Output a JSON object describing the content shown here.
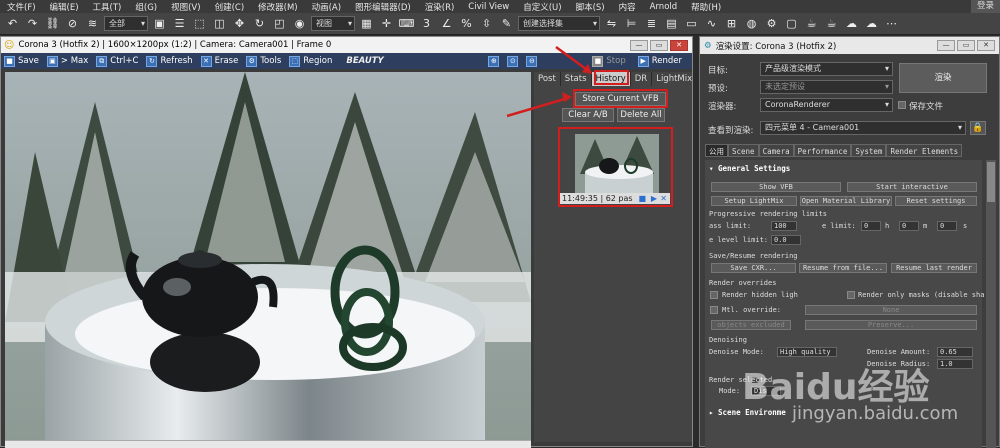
{
  "menu": {
    "items": [
      "文件(F)",
      "编辑(E)",
      "工具(T)",
      "组(G)",
      "视图(V)",
      "创建(C)",
      "修改器(M)",
      "动画(A)",
      "图形编辑器(D)",
      "渲染(R)",
      "Civil View",
      "自定义(U)",
      "脚本(S)",
      "内容",
      "Arnold",
      "帮助(H)"
    ],
    "login": "登录"
  },
  "toolbar": {
    "selection_filter": "全部",
    "view": "视图",
    "selection_set": "创建选择集"
  },
  "vfb": {
    "title": "Corona 3 (Hotfix 2) | 1600×1200px (1:2) | Camera: Camera001 | Frame 0",
    "tools": {
      "save": "Save",
      "max": "> Max",
      "ctrlc": "Ctrl+C",
      "refresh": "Refresh",
      "erase": "Erase",
      "tools": "Tools",
      "region": "Region",
      "channel": "BEAUTY"
    },
    "stop": "Stop",
    "render": "Render",
    "side_tabs": [
      "Post",
      "Stats",
      "History",
      "DR",
      "LightMix"
    ],
    "store_vfb": "Store Current VFB",
    "clear_ab": "Clear A/B",
    "delete_all": "Delete All",
    "thumb_info": "11:49:35 | 62 pas"
  },
  "render_setup": {
    "title": "渲染设置: Corona 3 (Hotfix 2)",
    "target_label": "目标:",
    "target_value": "产品级渲染模式",
    "preset_label": "预设:",
    "preset_value": "未选定预设",
    "renderer_label": "渲染器:",
    "renderer_value": "CoronaRenderer",
    "save_file": "保存文件",
    "render_button": "渲染",
    "view_label": "查看到渲染:",
    "view_value": "四元菜单 4 - Camera001",
    "tabs": [
      "公用",
      "Scene",
      "Camera",
      "Performance",
      "System",
      "Render Elements"
    ],
    "general_settings": "General Settings",
    "show_vfb": "Show VFB",
    "start_interactive": "Start interactive",
    "setup_lightmix": "Setup LightMix",
    "open_material_library": "Open Material Library",
    "reset_settings": "Reset settings",
    "progressive_limits": "Progressive rendering limits",
    "pass_limit_label": "ass limit:",
    "pass_limit_value": "100",
    "time_limit_label": "e limit:",
    "time_h": "0",
    "time_m": "0",
    "time_s": "0",
    "h": "h",
    "m": "m",
    "s": "s",
    "noise_label": "e level limit:",
    "noise_value": "0.0",
    "save_resume": "Save/Resume rendering",
    "save_cxr": "Save CXR...",
    "resume_file": "Resume from file...",
    "resume_last": "Resume last render",
    "render_overrides": "Render overrides",
    "render_hidden": "Render hidden ligh",
    "render_only_masks": "Render only masks (disable sha",
    "mtl_override": "Mtl. override:",
    "none": "None",
    "objects_excluded": "objects excluded",
    "preserve": "Preserve...",
    "denoising": "Denoising",
    "denoise_mode_label": "Denoise Mode:",
    "denoise_mode_value": "High quality",
    "denoise_amount_label": "Denoise Amount:",
    "denoise_amount_value": "0.65",
    "denoise_radius_label": "Denoise Radius:",
    "denoise_radius_value": "1.0",
    "render_selected": "Render selected",
    "mode_label": "Mode:",
    "mode_value": "Dis",
    "scene_environment": "Scene Environme"
  },
  "watermark": {
    "text": "Baidu经验",
    "url": "jingyan.baidu.com"
  },
  "colors": {
    "accent": "#d21e1e",
    "vfb_toolbar": "#2d3e5e"
  }
}
